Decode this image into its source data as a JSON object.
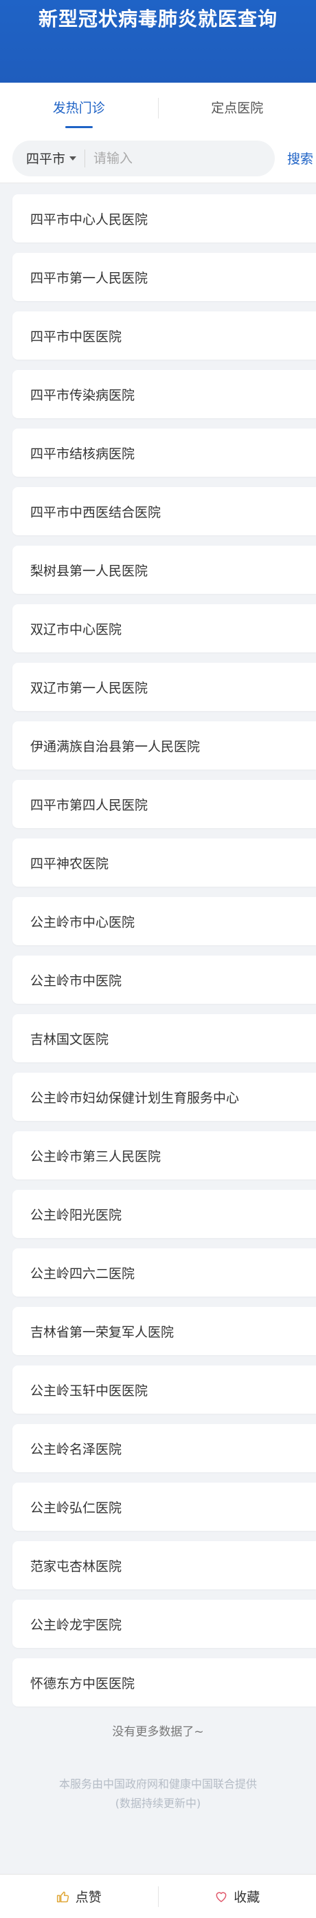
{
  "header": {
    "title": "新型冠状病毒肺炎就医查询"
  },
  "tabs": [
    {
      "label": "发热门诊",
      "active": true
    },
    {
      "label": "定点医院",
      "active": false
    }
  ],
  "search": {
    "city": "四平市",
    "placeholder": "请输入",
    "value": "",
    "button_label": "搜索"
  },
  "hospitals": [
    "四平市中心人民医院",
    "四平市第一人民医院",
    "四平市中医医院",
    "四平市传染病医院",
    "四平市结核病医院",
    "四平市中西医结合医院",
    "梨树县第一人民医院",
    "双辽市中心医院",
    "双辽市第一人民医院",
    "伊通满族自治县第一人民医院",
    "四平市第四人民医院",
    "四平神农医院",
    "公主岭市中心医院",
    "公主岭市中医院",
    "吉林国文医院",
    "公主岭市妇幼保健计划生育服务中心",
    "公主岭市第三人民医院",
    "公主岭阳光医院",
    "公主岭四六二医院",
    "吉林省第一荣复军人医院",
    "公主岭玉轩中医医院",
    "公主岭名泽医院",
    "公主岭弘仁医院",
    "范家屯杏林医院",
    "公主岭龙宇医院",
    "怀德东方中医医院"
  ],
  "list_end": "没有更多数据了~",
  "footer": {
    "line1": "本服务由中国政府网和健康中国联合提供",
    "line2": "(数据持续更新中)"
  },
  "bottom_bar": {
    "like_label": "点赞",
    "like_icon": "thumbs-up-icon",
    "favorite_label": "收藏",
    "favorite_icon": "heart-icon"
  },
  "colors": {
    "brand": "#1f63c6",
    "background": "#f1f3f6",
    "like_icon": "#e0a83a",
    "favorite_icon": "#e0576a"
  }
}
